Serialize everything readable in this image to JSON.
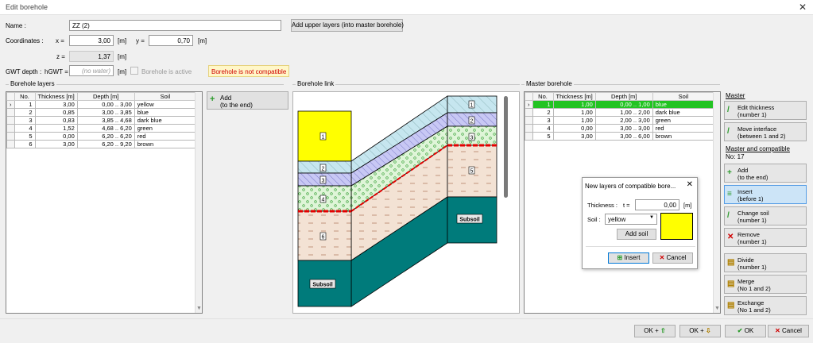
{
  "window": {
    "title": "Edit borehole",
    "close": "✕"
  },
  "top": {
    "name_label": "Name :",
    "name_value": "ZZ (2)",
    "add_upper_label": "Add upper layers (into master borehole)",
    "coord_label": "Coordinates :",
    "x_label": "x =",
    "x_value": "3,00",
    "x_unit": "[m]",
    "y_label": "y =",
    "y_value": "0,70",
    "y_unit": "[m]",
    "z_label": "z =",
    "z_value": "1,37",
    "z_unit": "[m]",
    "gwt_label": "GWT depth :",
    "gwt_sym": "hGWT =",
    "gwt_placeholder": "(no water)",
    "gwt_unit": "[m]",
    "active_label": "Borehole is active",
    "not_compatible": "Borehole is not compatible"
  },
  "borehole_layers": {
    "title": "Borehole layers",
    "headers": [
      "No.",
      "Thickness [m]",
      "Depth [m]",
      "Soil"
    ],
    "rows": [
      {
        "no": "1",
        "thick": "3,00",
        "depth": "0,00 .. 3,00",
        "soil": "yellow"
      },
      {
        "no": "2",
        "thick": "0,85",
        "depth": "3,00 .. 3,85",
        "soil": "blue"
      },
      {
        "no": "3",
        "thick": "0,83",
        "depth": "3,85 .. 4,68",
        "soil": "dark blue"
      },
      {
        "no": "4",
        "thick": "1,52",
        "depth": "4,68 .. 6,20",
        "soil": "green"
      },
      {
        "no": "5",
        "thick": "0,00",
        "depth": "6,20 .. 6,20",
        "soil": "red"
      },
      {
        "no": "6",
        "thick": "3,00",
        "depth": "6,20 .. 9,20",
        "soil": "brown"
      }
    ],
    "add_label": "Add",
    "add_sub": "(to the end)"
  },
  "link": {
    "title": "Borehole link",
    "subsoil": "Subsoil",
    "nums_left": [
      "1",
      "2",
      "3",
      "4",
      "6"
    ],
    "nums_right": [
      "1",
      "2",
      "3",
      "5"
    ]
  },
  "master": {
    "title": "Master borehole",
    "headers": [
      "No.",
      "Thickness [m]",
      "Depth [m]",
      "Soil"
    ],
    "rows": [
      {
        "no": "1",
        "thick": "1,00",
        "depth": "0,00 .. 1,00",
        "soil": "blue"
      },
      {
        "no": "2",
        "thick": "1,00",
        "depth": "1,00 .. 2,00",
        "soil": "dark blue"
      },
      {
        "no": "3",
        "thick": "1,00",
        "depth": "2,00 .. 3,00",
        "soil": "green"
      },
      {
        "no": "4",
        "thick": "0,00",
        "depth": "3,00 .. 3,00",
        "soil": "red"
      },
      {
        "no": "5",
        "thick": "3,00",
        "depth": "3,00 .. 6,00",
        "soil": "brown"
      }
    ]
  },
  "side": {
    "master_label": "Master",
    "mc_label": "Master and compatible",
    "mc_no": "No: 17",
    "buttons": [
      {
        "l1": "Edit thickness",
        "l2": "(number 1)",
        "icon": "pencil-icon"
      },
      {
        "l1": "Move interface",
        "l2": "(between 1 and 2)",
        "icon": "move-icon"
      },
      {
        "l1": "Add",
        "l2": "(to the end)",
        "icon": "plus-icon"
      },
      {
        "l1": "Insert",
        "l2": "(before 1)",
        "icon": "insert-icon"
      },
      {
        "l1": "Change soil",
        "l2": "(number 1)",
        "icon": "change-icon"
      },
      {
        "l1": "Remove",
        "l2": "(number 1)",
        "icon": "remove-icon"
      },
      {
        "l1": "Divide",
        "l2": "(number 1)",
        "icon": "divide-icon"
      },
      {
        "l1": "Merge",
        "l2": "(No 1 and 2)",
        "icon": "merge-icon"
      },
      {
        "l1": "Exchange",
        "l2": "(No 1 and 2)",
        "icon": "exchange-icon"
      }
    ]
  },
  "dialog": {
    "title": "New layers of compatible bore...",
    "close": "✕",
    "thick_label": "Thickness :",
    "t_label": "t =",
    "t_value": "0,00",
    "t_unit": "[m]",
    "soil_label": "Soil :",
    "soil_value": "yellow",
    "add_soil": "Add soil",
    "insert": "Insert",
    "cancel": "Cancel"
  },
  "bottom": {
    "ok_up": "OK +",
    "ok_down": "OK +",
    "ok": "OK",
    "cancel": "Cancel"
  },
  "colors": {
    "yellow": "#ffff00",
    "blue": "#c6e6ef",
    "darkblue": "#c8c8f4",
    "green": "#dff5d8",
    "brown": "#f3e2d4",
    "teal": "#007b7b",
    "red": "#e40000",
    "selected": "#22c322"
  }
}
